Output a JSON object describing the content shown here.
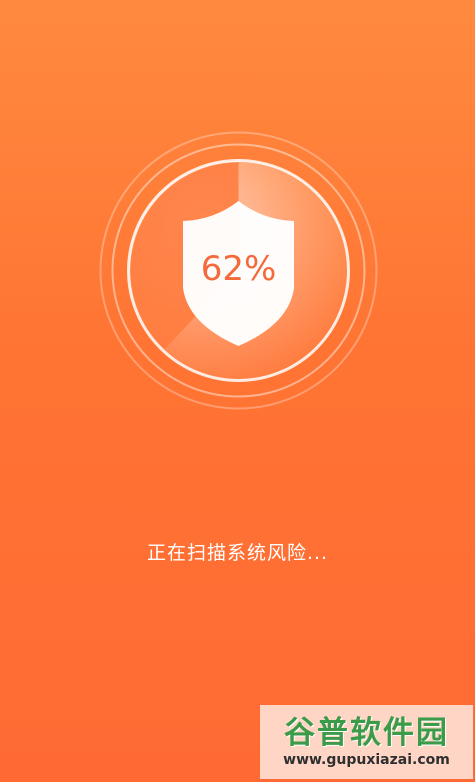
{
  "scan": {
    "progress_text": "62%",
    "progress_value": 62,
    "status_text": "正在扫描系统风险..."
  },
  "watermark": {
    "logo_text": "谷普软件园",
    "url_text": "www.gupuxiazai.com"
  },
  "colors": {
    "background_top": "#ff8a3f",
    "background_bottom": "#ff6a34",
    "accent": "#f46a3a",
    "text": "#ffffff",
    "watermark_logo": "#3b9b48"
  },
  "icons": {
    "shield": "shield-icon"
  }
}
